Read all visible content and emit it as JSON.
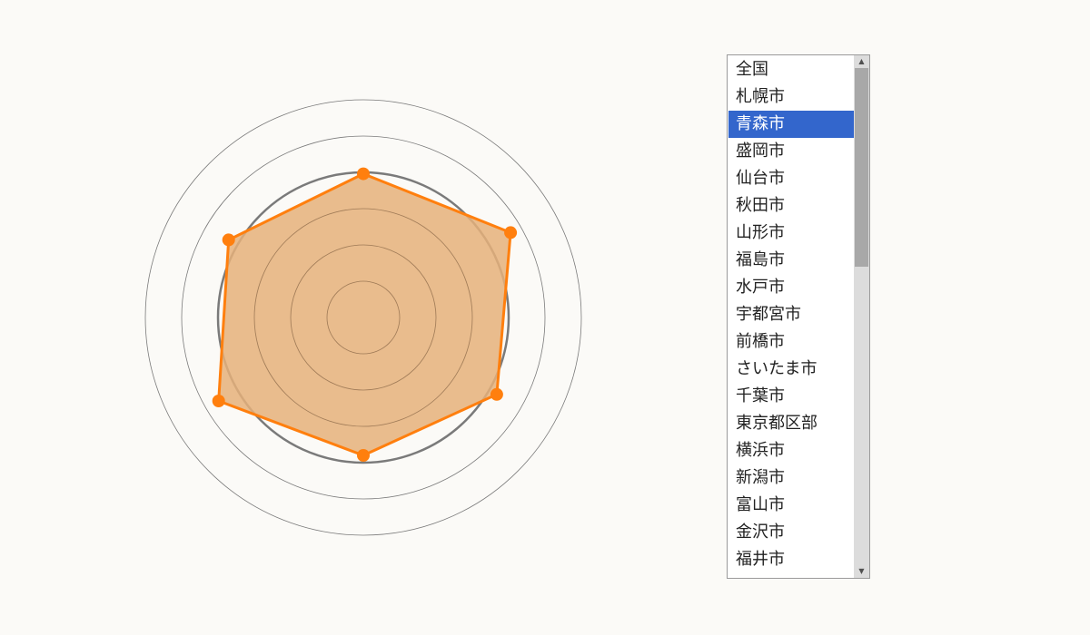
{
  "chart_data": {
    "type": "radar",
    "axes": 6,
    "ring_count": 6,
    "highlight_ring": 4,
    "values": [
      0.99,
      1.17,
      1.06,
      0.95,
      1.15,
      1.07
    ],
    "colors": {
      "fill": "#e5b07a",
      "stroke": "#ff7f0e",
      "point": "#ff7f0e",
      "ring": "#7a7a7a"
    }
  },
  "city_list": {
    "selected_index": 2,
    "items": [
      "全国",
      "札幌市",
      "青森市",
      "盛岡市",
      "仙台市",
      "秋田市",
      "山形市",
      "福島市",
      "水戸市",
      "宇都宮市",
      "前橋市",
      "さいたま市",
      "千葉市",
      "東京都区部",
      "横浜市",
      "新潟市",
      "富山市",
      "金沢市",
      "福井市"
    ]
  },
  "scrollbar": {
    "up_icon": "▲",
    "down_icon": "▼",
    "position": 0.0,
    "visible_fraction": 0.4
  }
}
